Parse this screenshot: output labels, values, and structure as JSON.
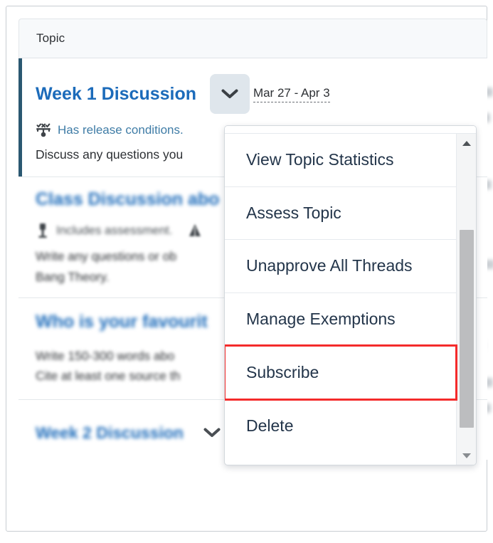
{
  "table": {
    "column_header": "Topic"
  },
  "rows": [
    {
      "title": "Week 1 Discussion",
      "date_range": "Mar 27 - Apr 3",
      "meta": "Has release conditions.",
      "meta_icon": "release-conditions-icon",
      "description": "Discuss any questions you",
      "selected": true,
      "blurred": false,
      "chevron": "chevron-down-icon",
      "chevron_style": "filled"
    },
    {
      "title": "Class Discussion abo",
      "meta": "Includes assessment.",
      "meta_icon": "assessment-icon",
      "meta_icon_2": "group-icon",
      "description_line_1": "Write any questions or ob",
      "description_line_2": "Bang Theory.",
      "selected": false,
      "blurred": true
    },
    {
      "title": "Who is your favourit",
      "description_line_1": "Write 150-300 words abo",
      "description_line_2": "Cite at least one source th",
      "selected": false,
      "blurred": true
    },
    {
      "title": "Week 2 Discussion",
      "selected": false,
      "blurred": true,
      "chevron": "chevron-down-icon",
      "chevron_style": "plain"
    }
  ],
  "context_menu": {
    "items": [
      {
        "label": "View Topic Statistics",
        "highlighted": false
      },
      {
        "label": "Assess Topic",
        "highlighted": false
      },
      {
        "label": "Unapprove All Threads",
        "highlighted": false
      },
      {
        "label": "Manage Exemptions",
        "highlighted": false
      },
      {
        "label": "Subscribe",
        "highlighted": true
      },
      {
        "label": "Delete",
        "highlighted": false
      }
    ],
    "scrollbar": {
      "up_arrow_icon": "triangle-up-icon",
      "down_arrow_icon": "triangle-down-icon"
    }
  },
  "colors": {
    "link_blue": "#1c6bba",
    "accent_bar": "#2b5871",
    "highlight_red": "#f42b2b",
    "header_bg": "#f7f9fb",
    "chevron_btn_bg": "#dfe6ec"
  }
}
